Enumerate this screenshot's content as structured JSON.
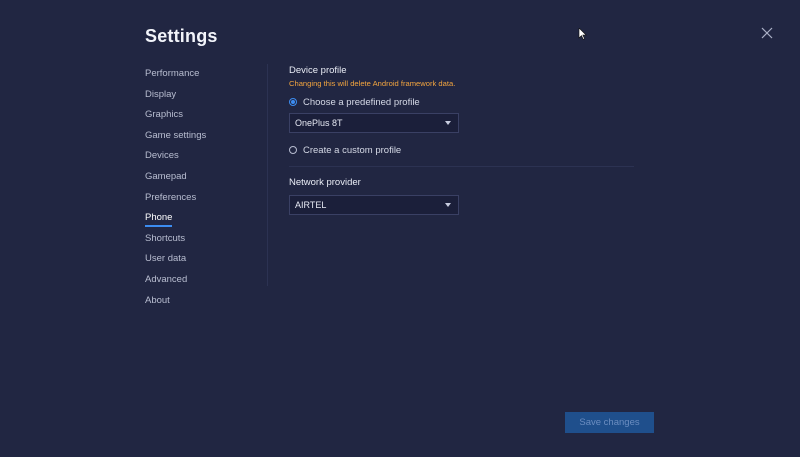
{
  "header": {
    "title": "Settings",
    "close_icon": "close-icon"
  },
  "sidebar": {
    "items": [
      {
        "label": "Performance"
      },
      {
        "label": "Display"
      },
      {
        "label": "Graphics"
      },
      {
        "label": "Game settings"
      },
      {
        "label": "Devices"
      },
      {
        "label": "Gamepad"
      },
      {
        "label": "Preferences"
      },
      {
        "label": "Phone",
        "active": true
      },
      {
        "label": "Shortcuts"
      },
      {
        "label": "User data"
      },
      {
        "label": "Advanced"
      },
      {
        "label": "About"
      }
    ]
  },
  "device_profile": {
    "title": "Device profile",
    "warning": "Changing this will delete Android framework data.",
    "option_predefined": "Choose a predefined profile",
    "predefined_selected": true,
    "profile_value": "OnePlus 8T",
    "option_custom": "Create a custom profile"
  },
  "network": {
    "title": "Network provider",
    "value": "AIRTEL"
  },
  "footer": {
    "save_label": "Save changes"
  },
  "colors": {
    "background": "#212642",
    "accent": "#3c8cf0",
    "warning": "#f3a53f",
    "button": "#1f4f8c"
  }
}
